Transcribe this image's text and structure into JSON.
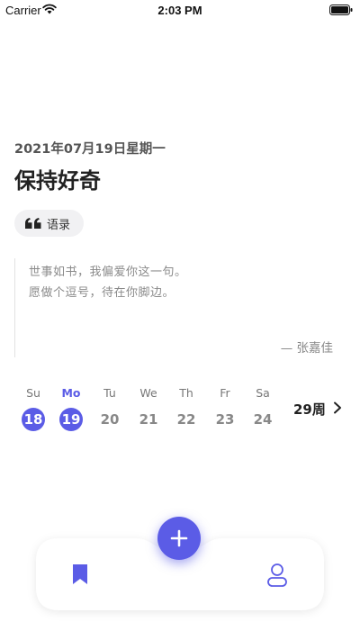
{
  "status_bar": {
    "carrier": "Carrier",
    "time": "2:03 PM"
  },
  "header": {
    "date": "2021年07月19日星期一",
    "title": "保持好奇"
  },
  "quote_chip": {
    "icon": "quote-icon",
    "label": "语录"
  },
  "quote": {
    "lines": [
      "世事如书，我偏爱你这一句。",
      "愿做个逗号，待在你脚边。"
    ],
    "author": "— 张嘉佳"
  },
  "calendar": {
    "days": [
      {
        "weekday": "Su",
        "date": "18",
        "selected": true,
        "today": false
      },
      {
        "weekday": "Mo",
        "date": "19",
        "selected": true,
        "today": true
      },
      {
        "weekday": "Tu",
        "date": "20",
        "selected": false,
        "today": false
      },
      {
        "weekday": "We",
        "date": "21",
        "selected": false,
        "today": false
      },
      {
        "weekday": "Th",
        "date": "22",
        "selected": false,
        "today": false
      },
      {
        "weekday": "Fr",
        "date": "23",
        "selected": false,
        "today": false
      },
      {
        "weekday": "Sa",
        "date": "24",
        "selected": false,
        "today": false
      }
    ],
    "week_label": "29周"
  },
  "tabbar": {
    "left_icon": "bookmark-icon",
    "center_icon": "plus-icon",
    "right_icon": "profile-icon"
  },
  "colors": {
    "accent": "#5b5ce6",
    "text": "#222222",
    "muted": "#888888"
  }
}
